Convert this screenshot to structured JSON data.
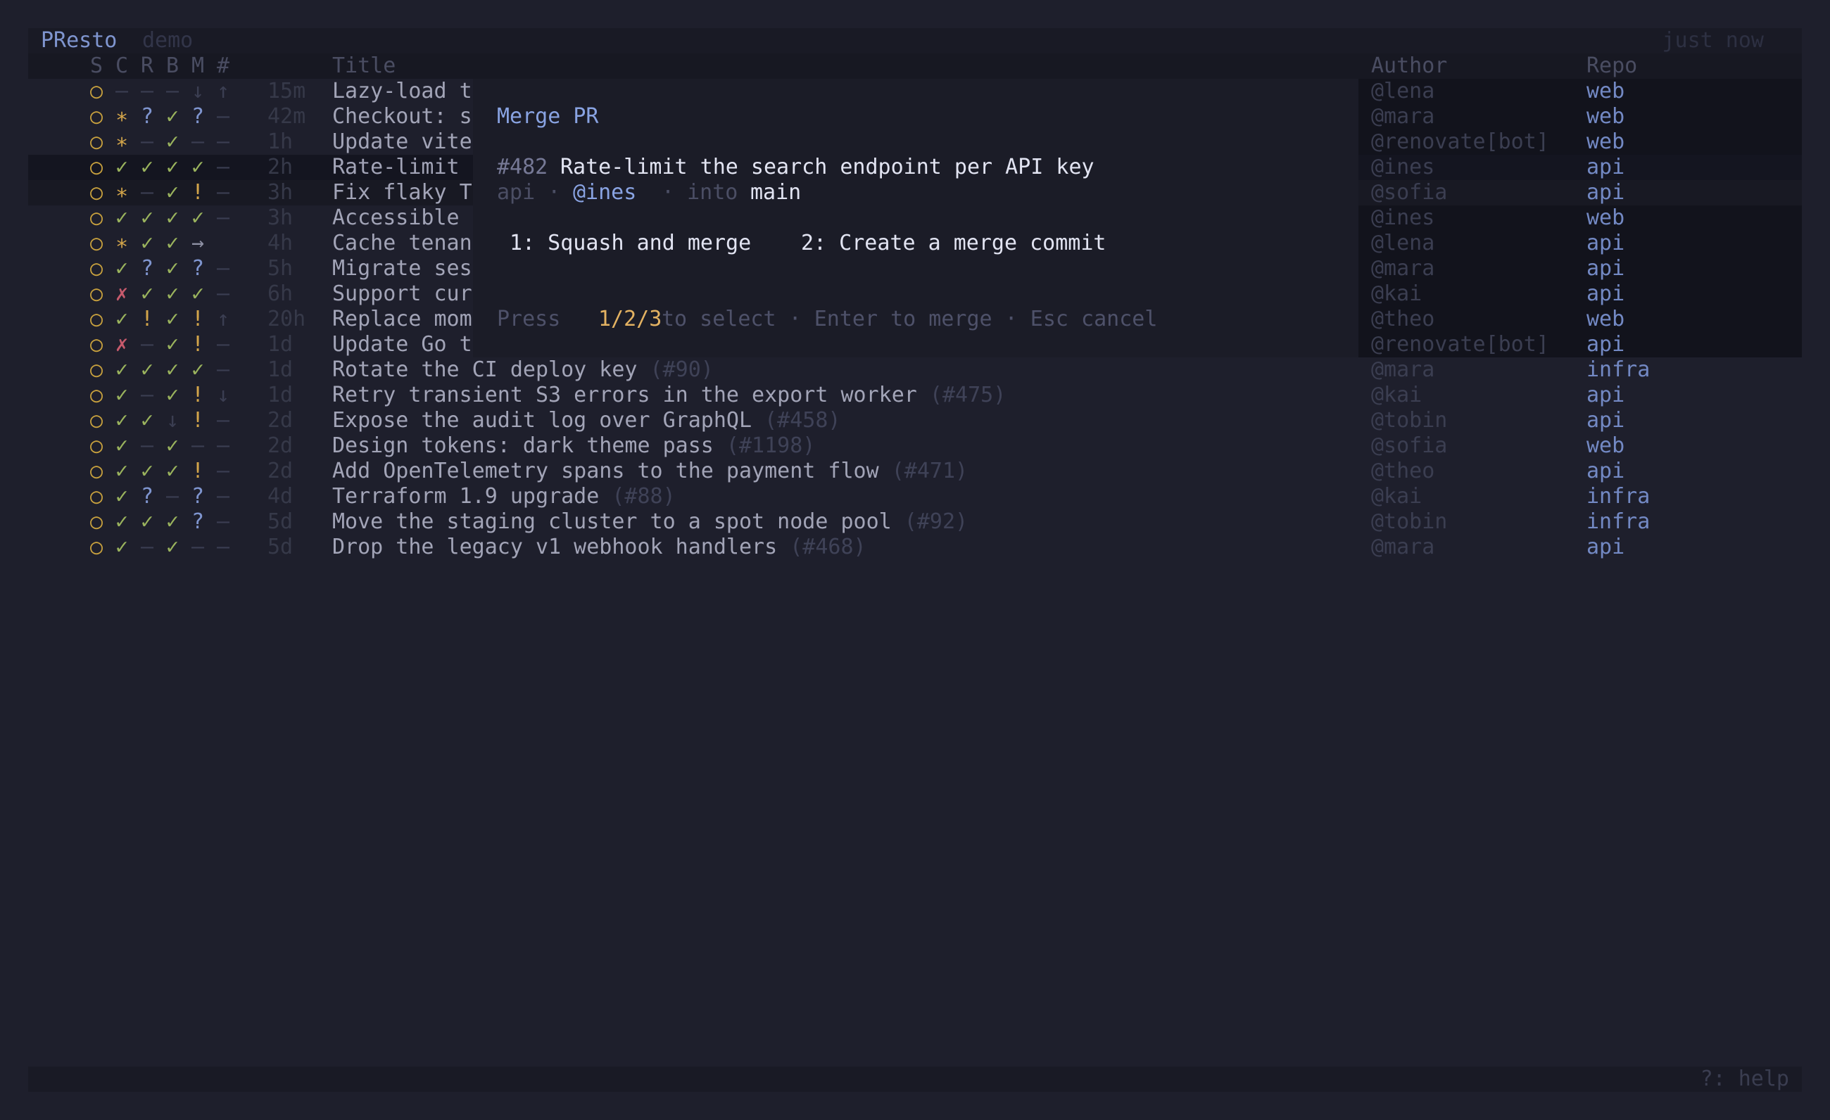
{
  "app": {
    "name": "PResto",
    "profile": "demo",
    "updated": "just now"
  },
  "columns": {
    "s": "S",
    "c": "C",
    "r": "R",
    "b": "B",
    "m": "M",
    "num": "#",
    "title": "Title",
    "author": "Author",
    "repo": "Repo"
  },
  "rows": [
    {
      "s": "○",
      "c": "–",
      "r": "–",
      "b": "–",
      "m": "↓",
      "n": "↑",
      "age": "15m",
      "title": "Lazy-load t",
      "author": "@lena",
      "repo": "web"
    },
    {
      "s": "○",
      "c": "∗",
      "r": "?",
      "b": "✓",
      "m": "?",
      "n": "–",
      "age": "42m",
      "title": "Checkout: s",
      "author": "@mara",
      "repo": "web"
    },
    {
      "s": "○",
      "c": "∗",
      "r": "–",
      "b": "✓",
      "m": "–",
      "n": "–",
      "age": "1h",
      "title": "Update vite",
      "author": "@renovate[bot]",
      "repo": "web"
    },
    {
      "s": "○",
      "c": "✓",
      "r": "✓",
      "b": "✓",
      "m": "✓",
      "n": "–",
      "age": "2h",
      "title": "Rate-limit ",
      "author": "@ines",
      "repo": "api"
    },
    {
      "s": "○",
      "c": "∗",
      "r": "–",
      "b": "✓",
      "m": "!",
      "n": "–",
      "age": "3h",
      "title": "Fix flaky T",
      "author": "@sofia",
      "repo": "api"
    },
    {
      "s": "○",
      "c": "✓",
      "r": "✓",
      "b": "✓",
      "m": "✓",
      "n": "–",
      "age": "3h",
      "title": "Accessible ",
      "author": "@ines",
      "repo": "web"
    },
    {
      "s": "○",
      "c": "∗",
      "r": "✓",
      "b": "✓",
      "m": "→",
      "n": "",
      "age": "4h",
      "title": "Cache tenan",
      "author": "@lena",
      "repo": "api"
    },
    {
      "s": "○",
      "c": "✓",
      "r": "?",
      "b": "✓",
      "m": "?",
      "n": "–",
      "age": "5h",
      "title": "Migrate ses",
      "author": "@mara",
      "repo": "api"
    },
    {
      "s": "○",
      "c": "✗",
      "r": "✓",
      "b": "✓",
      "m": "✓",
      "n": "–",
      "age": "6h",
      "title": "Support cur",
      "author": "@kai",
      "repo": "api"
    },
    {
      "s": "○",
      "c": "✓",
      "r": "!",
      "b": "✓",
      "m": "!",
      "n": "↑",
      "age": "20h",
      "title": "Replace mom",
      "author": "@theo",
      "repo": "web"
    },
    {
      "s": "○",
      "c": "✗",
      "r": "–",
      "b": "✓",
      "m": "!",
      "n": "–",
      "age": "1d",
      "title": "Update Go t",
      "author": "@renovate[bot]",
      "repo": "api"
    },
    {
      "s": "○",
      "c": "✓",
      "r": "✓",
      "b": "✓",
      "m": "✓",
      "n": "–",
      "age": "1d",
      "title": "Rotate the CI deploy key",
      "num": "(#90)",
      "author": "@mara",
      "repo": "infra"
    },
    {
      "s": "○",
      "c": "✓",
      "r": "–",
      "b": "✓",
      "m": "!",
      "n": "↓",
      "age": "1d",
      "title": "Retry transient S3 errors in the export worker",
      "num": "(#475)",
      "author": "@kai",
      "repo": "api"
    },
    {
      "s": "○",
      "c": "✓",
      "r": "✓",
      "b": "↓",
      "m": "!",
      "n": "–",
      "age": "2d",
      "title": "Expose the audit log over GraphQL",
      "num": "(#458)",
      "author": "@tobin",
      "repo": "api"
    },
    {
      "s": "○",
      "c": "✓",
      "r": "–",
      "b": "✓",
      "m": "–",
      "n": "–",
      "age": "2d",
      "title": "Design tokens: dark theme pass",
      "num": "(#1198)",
      "author": "@sofia",
      "repo": "web"
    },
    {
      "s": "○",
      "c": "✓",
      "r": "✓",
      "b": "✓",
      "m": "!",
      "n": "–",
      "age": "2d",
      "title": "Add OpenTelemetry spans to the payment flow",
      "num": "(#471)",
      "author": "@theo",
      "repo": "api"
    },
    {
      "s": "○",
      "c": "✓",
      "r": "?",
      "b": "–",
      "m": "?",
      "n": "–",
      "age": "4d",
      "title": "Terraform 1.9 upgrade",
      "num": "(#88)",
      "author": "@kai",
      "repo": "infra"
    },
    {
      "s": "○",
      "c": "✓",
      "r": "✓",
      "b": "✓",
      "m": "?",
      "n": "–",
      "age": "5d",
      "title": "Move the staging cluster to a spot node pool",
      "num": "(#92)",
      "author": "@tobin",
      "repo": "infra"
    },
    {
      "s": "○",
      "c": "✓",
      "r": "–",
      "b": "✓",
      "m": "–",
      "n": "–",
      "age": "5d",
      "title": "Drop the legacy v1 webhook handlers",
      "num": "(#468)",
      "author": "@mara",
      "repo": "api"
    }
  ],
  "modal": {
    "title": "Merge PR",
    "pr_number": "#482",
    "pr_title": "Rate-limit the search endpoint per API key",
    "repo": "api",
    "sep1": "·",
    "author": "@ines",
    "sep2": "·",
    "into_label": "into",
    "branch": "main",
    "option1": "1: Squash and merge",
    "option2": "2: Create a merge commit",
    "help_prefix": "Press",
    "help_keys": "1/2/3",
    "help_suffix": "to select · Enter to merge · Esc cancel"
  },
  "footer": {
    "help": "?: help"
  },
  "colors": {
    "background": "#1e1f2c",
    "accent": "#7f95cf",
    "ok": "#9ab35d",
    "warn": "#d3a54a",
    "fail": "#c65a6c",
    "key": "#e3b262"
  }
}
